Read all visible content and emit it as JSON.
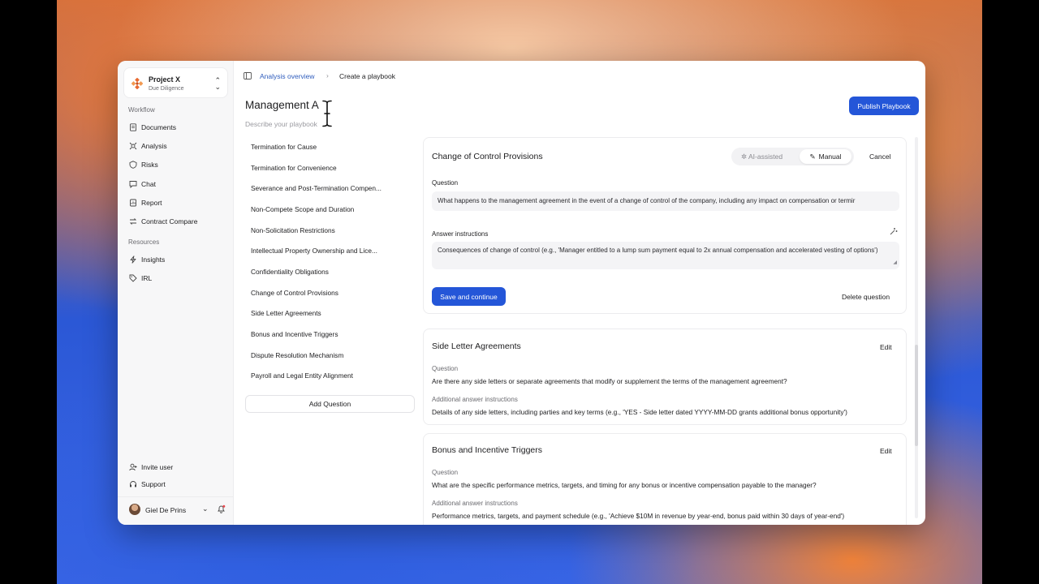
{
  "project": {
    "name": "Project X",
    "subtitle": "Due Diligence"
  },
  "sidebar": {
    "workflow_label": "Workflow",
    "workflow_items": [
      {
        "label": "Documents",
        "icon": "document-icon"
      },
      {
        "label": "Analysis",
        "icon": "analysis-icon"
      },
      {
        "label": "Risks",
        "icon": "risk-icon"
      },
      {
        "label": "Chat",
        "icon": "chat-icon"
      },
      {
        "label": "Report",
        "icon": "report-icon"
      },
      {
        "label": "Contract Compare",
        "icon": "compare-icon"
      }
    ],
    "resources_label": "Resources",
    "resource_items": [
      {
        "label": "Insights",
        "icon": "lightning-icon"
      },
      {
        "label": "IRL",
        "icon": "tag-icon"
      }
    ],
    "footer_items": [
      {
        "label": "Invite user",
        "icon": "invite-user-icon"
      },
      {
        "label": "Support",
        "icon": "headset-icon"
      }
    ],
    "user": {
      "name": "Giel De Prins"
    }
  },
  "breadcrumb": {
    "parent": "Analysis overview",
    "separator": "›",
    "current": "Create a playbook"
  },
  "header": {
    "publish_label": "Publish Playbook"
  },
  "playbook": {
    "title": "Management A",
    "description_placeholder": "Describe your playbook"
  },
  "questions": [
    "Termination for Cause",
    "Termination for Convenience",
    "Severance and Post-Termination Compen...",
    "Non-Compete Scope and Duration",
    "Non-Solicitation Restrictions",
    "Intellectual Property Ownership and Lice...",
    "Confidentiality Obligations",
    "Change of Control Provisions",
    "Side Letter Agreements",
    "Bonus and Incentive Triggers",
    "Dispute Resolution Mechanism",
    "Payroll and Legal Entity Alignment"
  ],
  "add_question_label": "Add Question",
  "editor": {
    "title": "Change of Control Provisions",
    "mode_ai": "AI-assisted",
    "mode_manual": "Manual",
    "cancel": "Cancel",
    "question_label": "Question",
    "question_value": "What happens to the management agreement in the event of a change of control of the company, including any impact on compensation or termir",
    "answer_label": "Answer instructions",
    "answer_value": "Consequences of change of control (e.g., 'Manager entitled to a lump sum payment equal to 2x annual compensation and accelerated vesting of options')",
    "save": "Save and continue",
    "delete": "Delete question"
  },
  "cards": [
    {
      "title": "Side Letter Agreements",
      "edit": "Edit",
      "question_label": "Question",
      "question": "Are there any side letters or separate agreements that modify or supplement the terms of the management agreement?",
      "instructions_label": "Additional answer instructions",
      "instructions": "Details of any side letters, including parties and key terms (e.g., 'YES - Side letter dated YYYY-MM-DD grants additional bonus opportunity')"
    },
    {
      "title": "Bonus and Incentive Triggers",
      "edit": "Edit",
      "question_label": "Question",
      "question": "What are the specific performance metrics, targets, and timing for any bonus or incentive compensation payable to the manager?",
      "instructions_label": "Additional answer instructions",
      "instructions": "Performance metrics, targets, and payment schedule (e.g., 'Achieve $10M in revenue by year-end, bonus paid within 30 days of year-end')"
    }
  ],
  "colors": {
    "accent": "#2456d8",
    "link": "#2f5dbd",
    "notification": "#e5484d"
  }
}
